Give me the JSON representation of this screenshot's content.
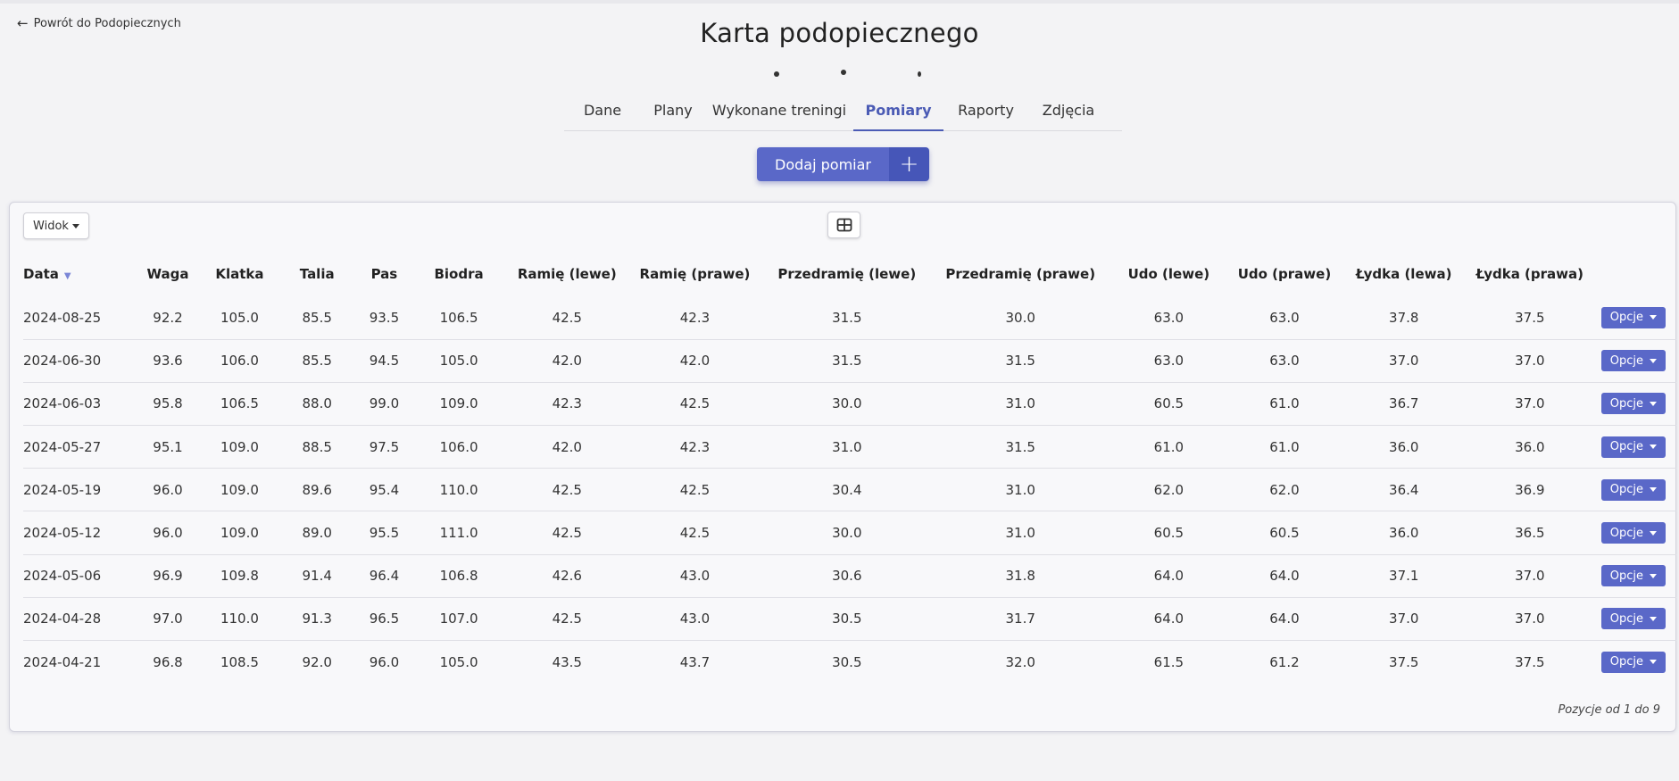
{
  "nav": {
    "back_label": "Powrót do Podopiecznych"
  },
  "page": {
    "title": "Karta podopiecznego"
  },
  "tabs": [
    {
      "label": "Dane"
    },
    {
      "label": "Plany"
    },
    {
      "label": "Wykonane treningi"
    },
    {
      "label": "Pomiary"
    },
    {
      "label": "Raporty"
    },
    {
      "label": "Zdjęcia"
    }
  ],
  "active_tab": "Pomiary",
  "actions": {
    "add_label": "Dodaj pomiar",
    "add_icon": "plus-icon"
  },
  "toolbar": {
    "view_label": "Widok",
    "grid_icon": "grid-icon"
  },
  "table": {
    "headers": [
      "Data",
      "Waga",
      "Klatka",
      "Talia",
      "Pas",
      "Biodra",
      "Ramię (lewe)",
      "Ramię (prawe)",
      "Przedramię (lewe)",
      "Przedramię (prawe)",
      "Udo (lewe)",
      "Udo (prawe)",
      "Łydka (lewa)",
      "Łydka (prawa)"
    ],
    "sort_column": "Data",
    "sort_direction": "desc",
    "rows": [
      [
        "2024-08-25",
        "92.2",
        "105.0",
        "85.5",
        "93.5",
        "106.5",
        "42.5",
        "42.3",
        "31.5",
        "30.0",
        "63.0",
        "63.0",
        "37.8",
        "37.5"
      ],
      [
        "2024-06-30",
        "93.6",
        "106.0",
        "85.5",
        "94.5",
        "105.0",
        "42.0",
        "42.0",
        "31.5",
        "31.5",
        "63.0",
        "63.0",
        "37.0",
        "37.0"
      ],
      [
        "2024-06-03",
        "95.8",
        "106.5",
        "88.0",
        "99.0",
        "109.0",
        "42.3",
        "42.5",
        "30.0",
        "31.0",
        "60.5",
        "61.0",
        "36.7",
        "37.0"
      ],
      [
        "2024-05-27",
        "95.1",
        "109.0",
        "88.5",
        "97.5",
        "106.0",
        "42.0",
        "42.3",
        "31.0",
        "31.5",
        "61.0",
        "61.0",
        "36.0",
        "36.0"
      ],
      [
        "2024-05-19",
        "96.0",
        "109.0",
        "89.6",
        "95.4",
        "110.0",
        "42.5",
        "42.5",
        "30.4",
        "31.0",
        "62.0",
        "62.0",
        "36.4",
        "36.9"
      ],
      [
        "2024-05-12",
        "96.0",
        "109.0",
        "89.0",
        "95.5",
        "111.0",
        "42.5",
        "42.5",
        "30.0",
        "31.0",
        "60.5",
        "60.5",
        "36.0",
        "36.5"
      ],
      [
        "2024-05-06",
        "96.9",
        "109.8",
        "91.4",
        "96.4",
        "106.8",
        "42.6",
        "43.0",
        "30.6",
        "31.8",
        "64.0",
        "64.0",
        "37.1",
        "37.0"
      ],
      [
        "2024-04-28",
        "97.0",
        "110.0",
        "91.3",
        "96.5",
        "107.0",
        "42.5",
        "43.0",
        "30.5",
        "31.7",
        "64.0",
        "64.0",
        "37.0",
        "37.0"
      ],
      [
        "2024-04-21",
        "96.8",
        "108.5",
        "92.0",
        "96.0",
        "105.0",
        "43.5",
        "43.7",
        "30.5",
        "32.0",
        "61.5",
        "61.2",
        "37.5",
        "37.5"
      ]
    ],
    "row_action_label": "Opcje",
    "footer": "Pozycje od 1 do 9"
  },
  "colors": {
    "accent": "#5a68c8",
    "accent_dark": "#4656b8",
    "background": "#f3f3f5"
  }
}
